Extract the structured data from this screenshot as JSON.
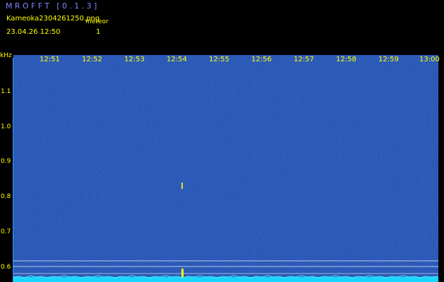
{
  "app": {
    "title": "MROFFT [0.1.3]"
  },
  "capture": {
    "filename": "Kameoka2304261250.png",
    "timestamp": "23.04.26  12:50",
    "meteor_label": "meteor",
    "meteor_count": "1"
  },
  "axis": {
    "unit": "kHz",
    "y_ticks": [
      "1.1",
      "1.0",
      "0.9",
      "0.8",
      "0.7",
      "0.6"
    ],
    "x_ticks": [
      "12:51",
      "12:52",
      "12:53",
      "12:54",
      "12:55",
      "12:56",
      "12:57",
      "12:58",
      "12:59",
      "13:00"
    ]
  },
  "colors": {
    "background": "#000000",
    "plot": "#0d1fa6",
    "text": "#ffff00",
    "title": "#7f86ff",
    "noise_floor": "#14d4ff",
    "meteor_echo": "#ffff00"
  }
}
